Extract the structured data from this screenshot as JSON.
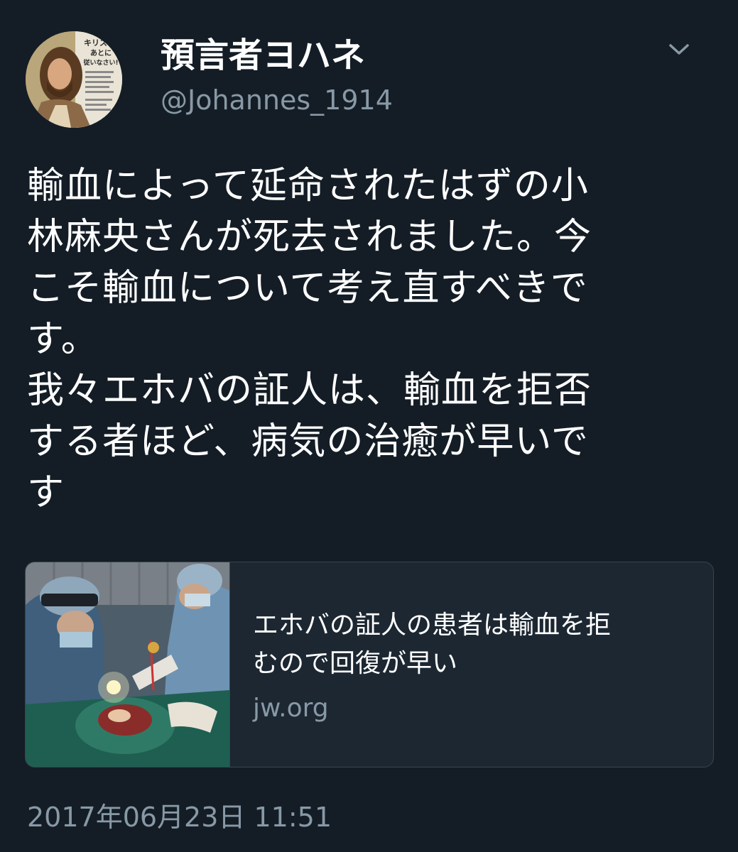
{
  "tweet": {
    "author": {
      "display_name": "預言者ヨハネ",
      "handle": "@Johannes_1914"
    },
    "text_lines": [
      "輸血によって延命されたはずの小",
      "林麻央さんが死去されました。今",
      "こそ輸血について考え直すべきで",
      "す。",
      "我々エホバの証人は、輸血を拒否",
      "する者ほど、病気の治癒が早いで",
      "す"
    ],
    "card": {
      "title_lines": [
        "エホバの証人の患者は輸血を拒",
        "むので回復が早い"
      ],
      "domain": "jw.org"
    },
    "timestamp": "2017年06月23日 11:51"
  },
  "avatar_text": [
    "キリスト",
    "あとに",
    "従いなさい!"
  ],
  "icons": {
    "menu": "chevron-down-icon"
  },
  "colors": {
    "background": "#141d26",
    "text": "#ffffff",
    "secondary_text": "#8899a6",
    "card_border": "#38444d"
  }
}
